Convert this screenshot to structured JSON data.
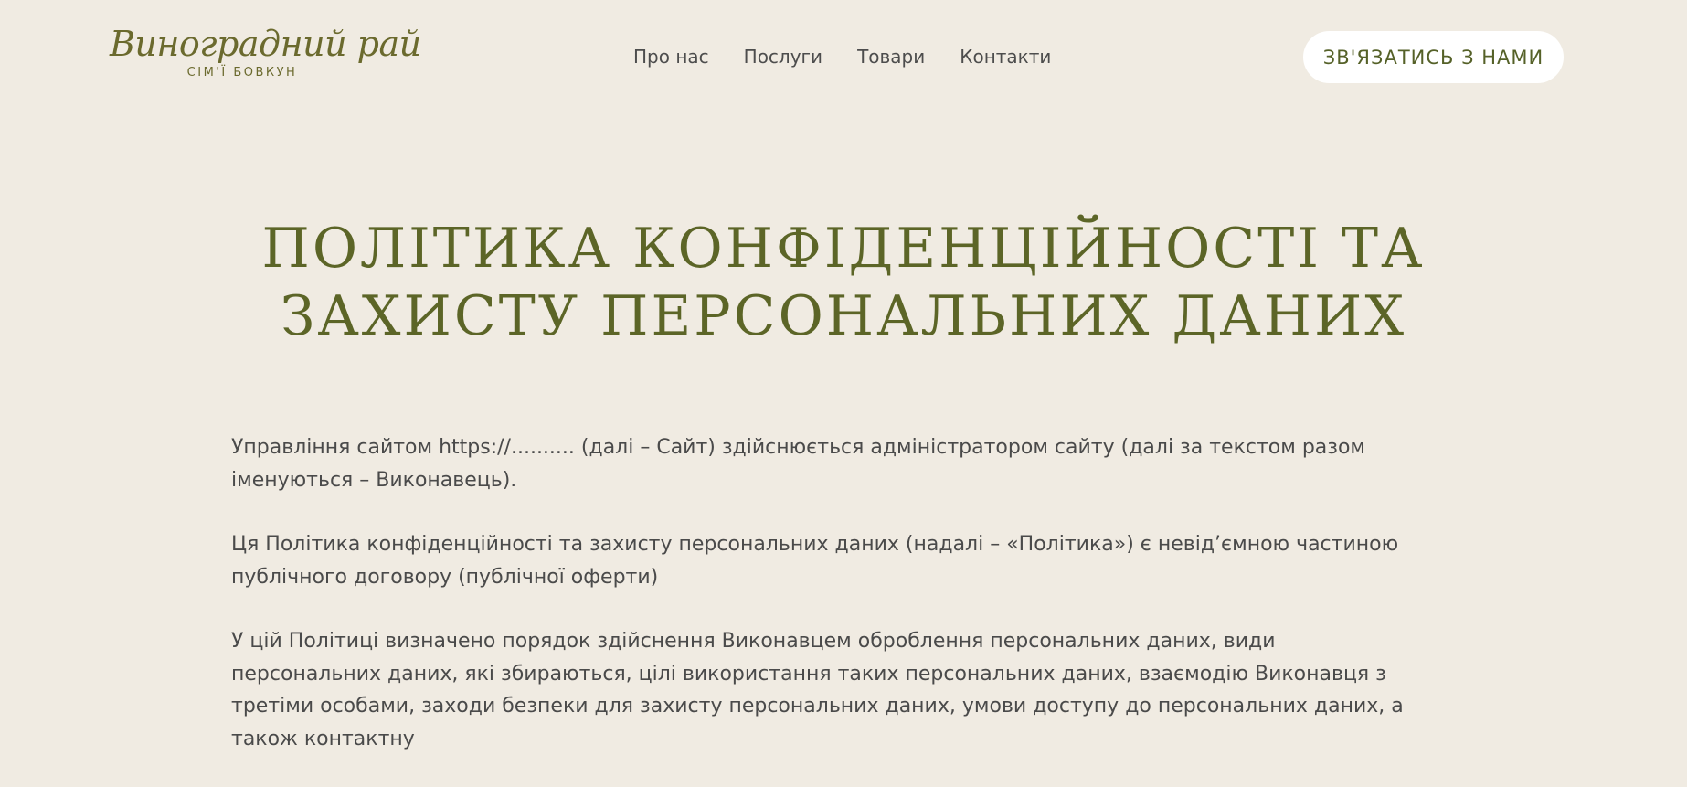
{
  "header": {
    "logo": {
      "script": "Виноградний рай",
      "subtitle": "СІМ'Ї БОВКУН"
    },
    "nav": [
      {
        "label": "Про нас"
      },
      {
        "label": "Послуги"
      },
      {
        "label": "Товари"
      },
      {
        "label": "Контакти"
      }
    ],
    "cta_label": "ЗВ'ЯЗАТИСЬ З НАМИ"
  },
  "main": {
    "title": "ПОЛІТИКА КОНФІДЕНЦІЙНОСТІ ТА ЗАХИСТУ ПЕРСОНАЛЬНИХ ДАНИХ",
    "paragraphs": [
      "Управління сайтом https://.......... (далі – Сайт) здійснюється адміністратором сайту (далі за текстом разом іменуються – Виконавець).",
      "Ця Політика конфіденційності та захисту персональних даних (надалі – «Політика») є невід’ємною частиною публічного договору (публічної оферти)",
      "У цій Політиці визначено порядок здійснення Виконавцем оброблення персональних даних, види персональних даних, які збираються, цілі використання таких персональних даних, взаємодію Виконавця з третіми особами, заходи безпеки для захисту персональних даних, умови доступу до персональних даних, а також контактну"
    ]
  },
  "colors": {
    "background": "#f0ebe2",
    "accent_olive": "#5c6527",
    "logo_olive": "#6b6a2e",
    "button_bg": "#ffffff",
    "body_text": "#4a4a4a"
  }
}
